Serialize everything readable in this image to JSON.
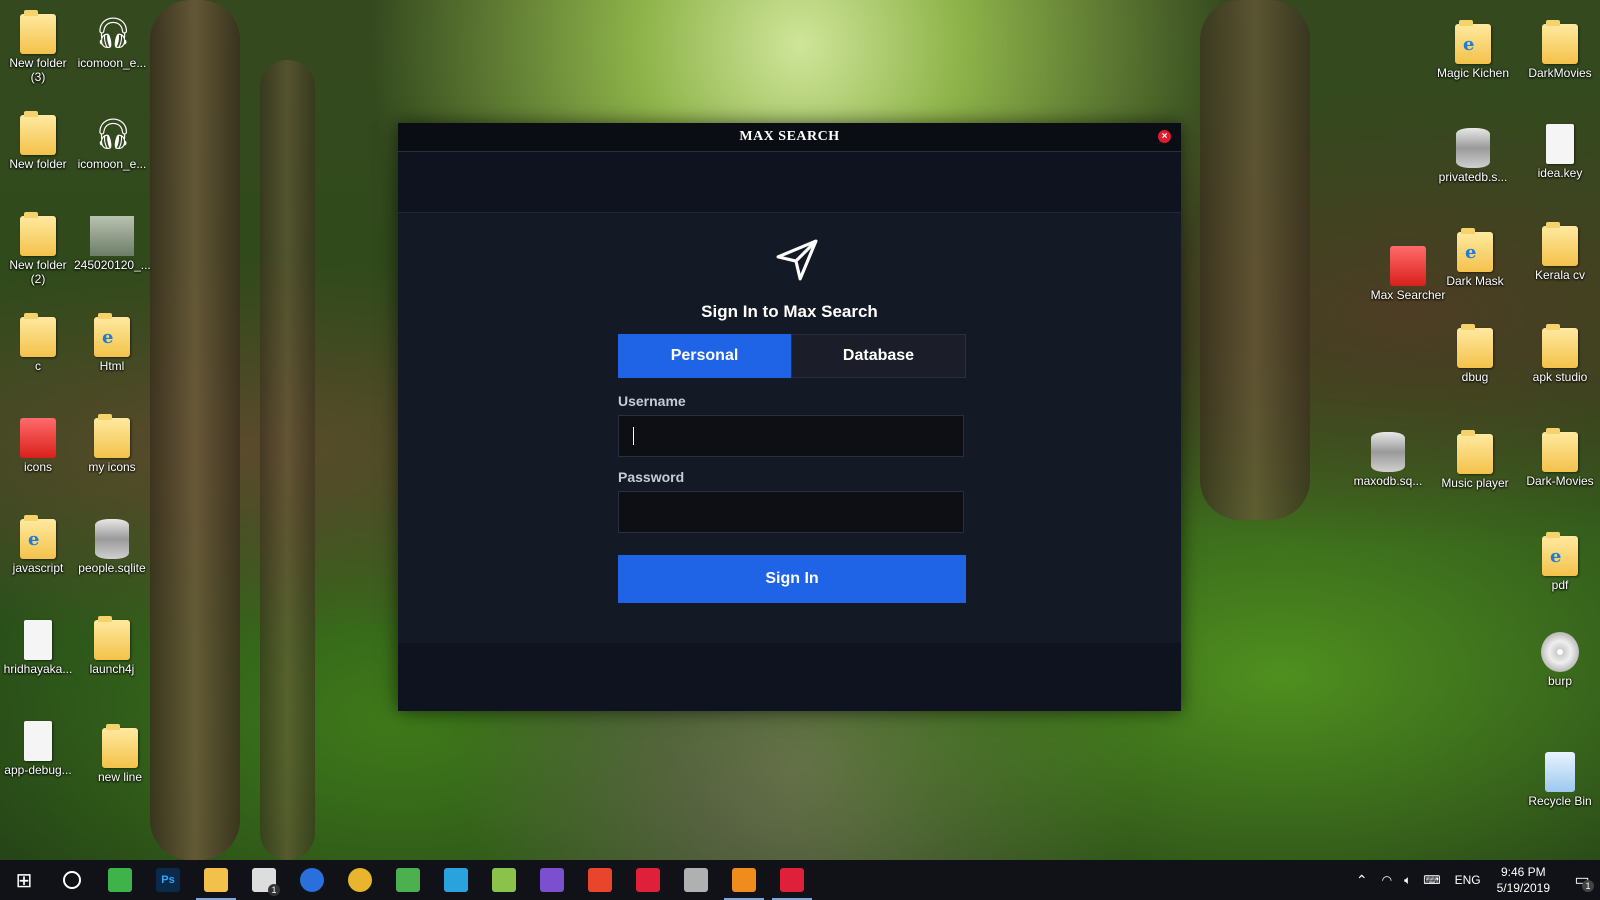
{
  "dialog": {
    "title": "MAX SEARCH",
    "heading": "Sign In to Max Search",
    "tabs": [
      {
        "label": "Personal",
        "active": true
      },
      {
        "label": "Database",
        "active": false
      }
    ],
    "username_label": "Username",
    "username_value": "",
    "password_label": "Password",
    "password_value": "",
    "signin_label": "Sign In",
    "accent_color": "#1f63e6"
  },
  "desktop": {
    "left_icons": [
      {
        "label": "New folder\n(3)",
        "icon": "folder-icon"
      },
      {
        "label": "icomoon_e...",
        "icon": "headphones-icon"
      },
      {
        "label": "New folder",
        "icon": "folder-icon"
      },
      {
        "label": "icomoon_e...",
        "icon": "headphones-icon"
      },
      {
        "label": "New folder\n(2)",
        "icon": "folder-icon"
      },
      {
        "label": "245020120_...",
        "icon": "photo-icon"
      },
      {
        "label": "c",
        "icon": "folder-icon"
      },
      {
        "label": "Html",
        "icon": "html-folder-icon"
      },
      {
        "label": "icons",
        "icon": "red-folder-icon"
      },
      {
        "label": "my icons",
        "icon": "folder-icon"
      },
      {
        "label": "javascript",
        "icon": "html-folder-icon"
      },
      {
        "label": "people.sqlite",
        "icon": "database-icon"
      },
      {
        "label": "hridhayaka...",
        "icon": "file-icon"
      },
      {
        "label": "launch4j",
        "icon": "folder-icon"
      },
      {
        "label": "app-debug...",
        "icon": "file-icon"
      },
      {
        "label": "new line",
        "icon": "folder-icon"
      }
    ],
    "right_icons": [
      {
        "label": "Magic Kichen",
        "icon": "html-folder-icon"
      },
      {
        "label": "DarkMovies",
        "icon": "folder-icon"
      },
      {
        "label": "privatedb.s...",
        "icon": "database-icon"
      },
      {
        "label": "idea.key",
        "icon": "file-icon"
      },
      {
        "label": "Max Searcher",
        "icon": "max-searcher-icon"
      },
      {
        "label": "Dark Mask",
        "icon": "html-folder-icon"
      },
      {
        "label": "Kerala cv",
        "icon": "folder-icon"
      },
      {
        "label": "dbug",
        "icon": "folder-icon"
      },
      {
        "label": "apk studio",
        "icon": "folder-icon"
      },
      {
        "label": "maxodb.sq...",
        "icon": "database-icon"
      },
      {
        "label": "Music player",
        "icon": "folder-icon"
      },
      {
        "label": "Dark-Movies",
        "icon": "folder-icon"
      },
      {
        "label": "pdf",
        "icon": "html-folder-icon"
      },
      {
        "label": "burp",
        "icon": "cd-icon"
      },
      {
        "label": "Recycle Bin",
        "icon": "recycle-bin-icon"
      }
    ]
  },
  "taskbar": {
    "apps": [
      {
        "name": "start-icon"
      },
      {
        "name": "cortana-icon"
      },
      {
        "name": "camtasia-icon"
      },
      {
        "name": "photoshop-icon",
        "text": "Ps"
      },
      {
        "name": "file-explorer-icon"
      },
      {
        "name": "mail-icon",
        "badge": "1"
      },
      {
        "name": "firefox-icon"
      },
      {
        "name": "chrome-icon"
      },
      {
        "name": "gem-icon"
      },
      {
        "name": "telegram-icon"
      },
      {
        "name": "notepad-plus-icon"
      },
      {
        "name": "visual-studio-icon"
      },
      {
        "name": "app-c-icon"
      },
      {
        "name": "max-search-icon"
      },
      {
        "name": "database-browser-icon"
      },
      {
        "name": "sublime-icon"
      },
      {
        "name": "max-search-running-icon"
      }
    ],
    "language": "ENG",
    "time": "9:46 PM",
    "date": "5/19/2019",
    "notification_count": "1"
  }
}
